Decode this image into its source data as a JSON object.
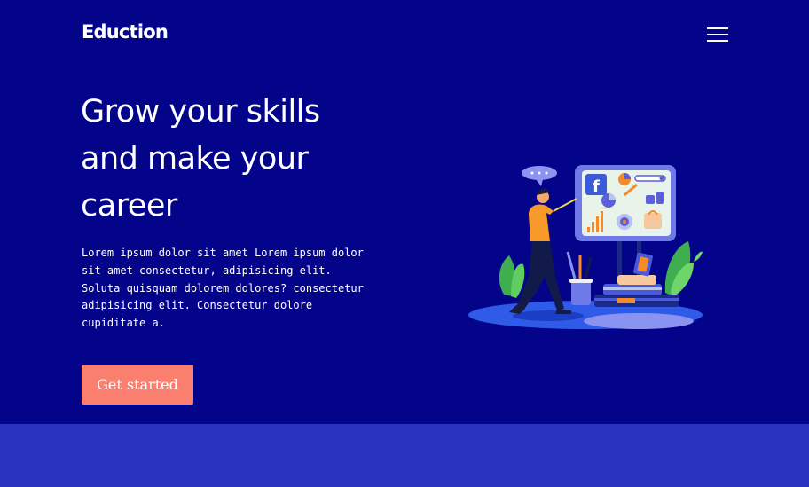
{
  "header": {
    "logo": "Eduction",
    "menu_icon": "hamburger-menu-icon"
  },
  "hero": {
    "headline": "Grow your skills and make your career",
    "description": "Lorem ipsum dolor sit amet Lorem ipsum dolor sit amet consectetur, adipisicing elit. Soluta quisquam dolorem dolores? consectetur adipisicing elit. Consectetur dolore cupiditate a.",
    "cta_label": "Get started",
    "illustration": "teacher-presenting-board-illustration"
  },
  "colors": {
    "hero_bg": "#04048a",
    "section_bg": "#2733bf",
    "cta_bg": "#fa7f6e",
    "text": "#ffffff"
  }
}
